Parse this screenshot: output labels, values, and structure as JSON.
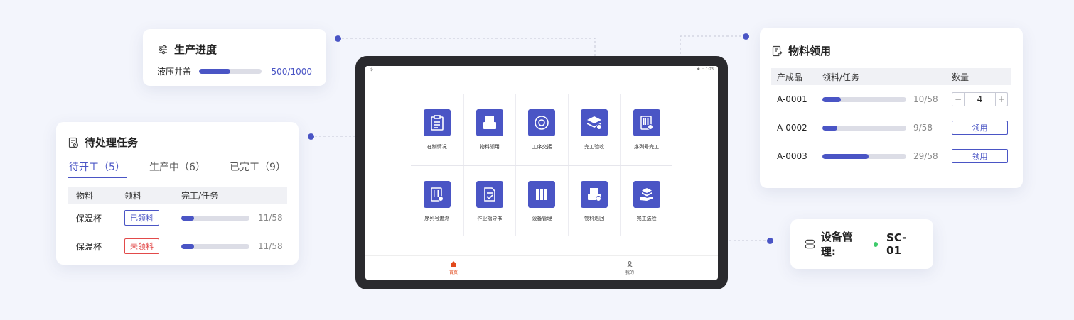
{
  "progress_card": {
    "title": "生产进度",
    "item": "液压井盖",
    "value": "500/1000",
    "fraction": 0.5,
    "icon": "sliders-icon"
  },
  "tasks_card": {
    "title": "待处理任务",
    "tabs": [
      "待开工（5）",
      "生产中（6）",
      "已完工（9）"
    ],
    "active_tab": 0,
    "columns": [
      "物料",
      "领料",
      "完工/任务"
    ],
    "rows": [
      {
        "material": "保温杯",
        "status": "已领料",
        "status_type": "ok",
        "count": "11/58",
        "fraction": 0.19
      },
      {
        "material": "保温杯",
        "status": "未领料",
        "status_type": "no",
        "count": "11/58",
        "fraction": 0.19
      }
    ]
  },
  "materials_card": {
    "title": "物料领用",
    "columns": [
      "产成品",
      "领料/任务",
      "数量"
    ],
    "rows": [
      {
        "product": "A-0001",
        "count": "10/58",
        "fraction": 0.22,
        "stepper_value": "4",
        "minus": "−",
        "plus": "+"
      },
      {
        "product": "A-0002",
        "count": "9/58",
        "fraction": 0.18,
        "button": "领用"
      },
      {
        "product": "A-0003",
        "count": "29/58",
        "fraction": 0.55,
        "button": "领用"
      }
    ]
  },
  "equipment_card": {
    "label": "设备管理:",
    "code": "SC-01",
    "status_color": "#3ecb6b"
  },
  "tablet": {
    "status_left": "令",
    "status_right": "✱ ▭ 1:23",
    "row1": [
      "在制情况",
      "物料领用",
      "工序交接",
      "完工验收",
      "序列号完工"
    ],
    "row2": [
      "序列号追溯",
      "作业指导书",
      "设备管理",
      "物料退回",
      "完工送检"
    ],
    "nav": [
      "首页",
      "我的"
    ]
  },
  "colors": {
    "accent": "#4a55c5",
    "danger": "#e24a4a",
    "nav_active": "#e24a1c"
  }
}
